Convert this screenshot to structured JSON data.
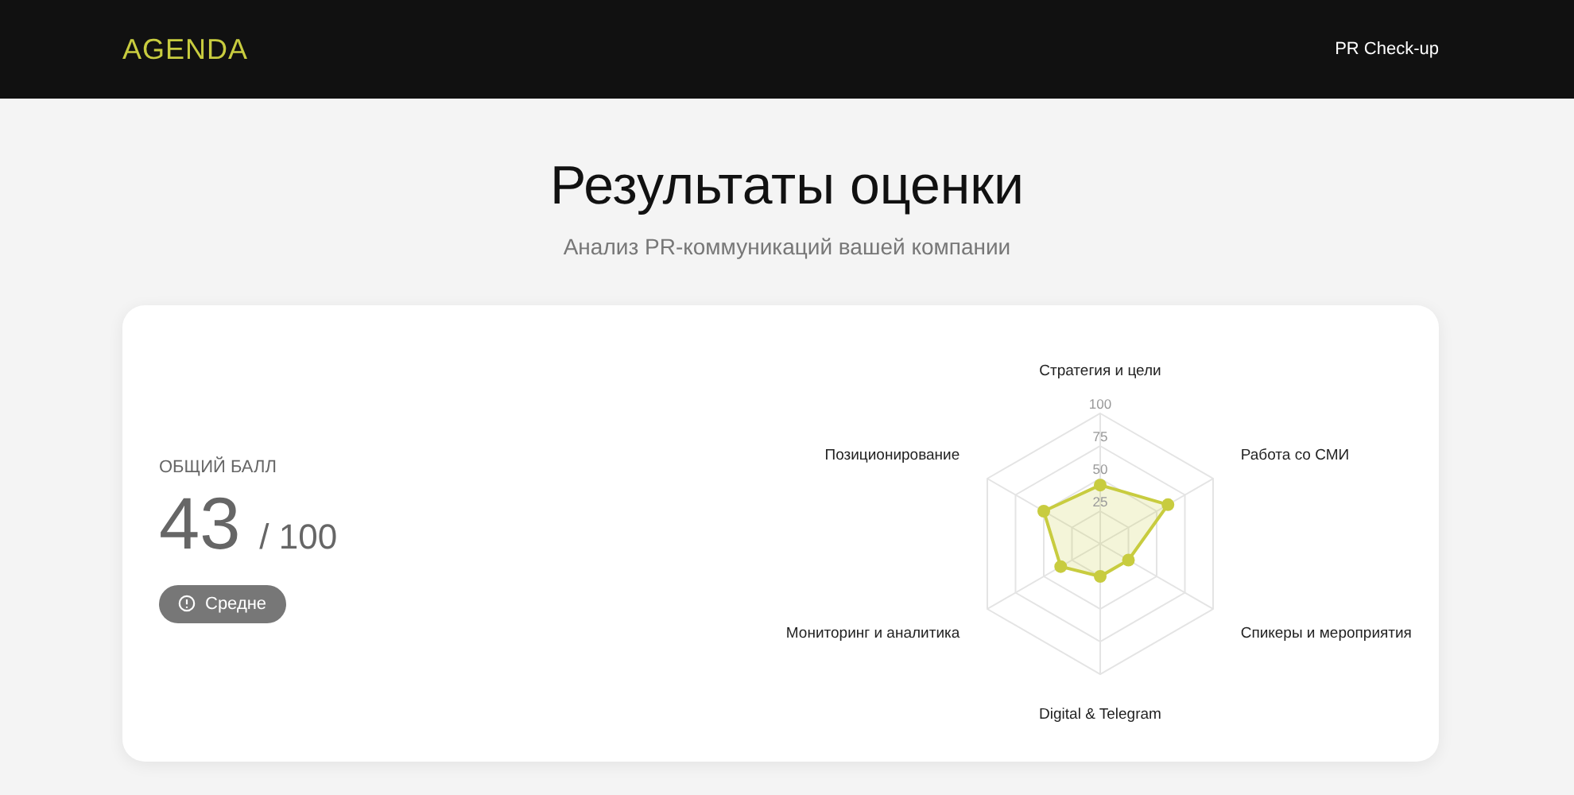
{
  "header": {
    "logo": "AGENDA",
    "nav_link": "PR Check-up"
  },
  "page": {
    "title": "Результаты оценки",
    "subtitle": "Анализ PR-коммуникаций вашей компании"
  },
  "score": {
    "label": "ОБЩИЙ БАЛЛ",
    "value": "43",
    "max": "/ 100",
    "badge": "Средне"
  },
  "chart": {
    "chart_data": {
      "type": "radar",
      "categories": [
        "Стратегия и цели",
        "Работа со СМИ",
        "Спикеры и мероприятия",
        "Digital & Telegram",
        "Мониторинг и аналитика",
        "Позиционирование"
      ],
      "series": [
        {
          "color": "#c8cc3f",
          "values": [
            45,
            60,
            25,
            25,
            35,
            50
          ]
        }
      ],
      "ylim": [
        0,
        100
      ],
      "yticks": [
        25,
        50,
        75,
        100
      ]
    }
  }
}
